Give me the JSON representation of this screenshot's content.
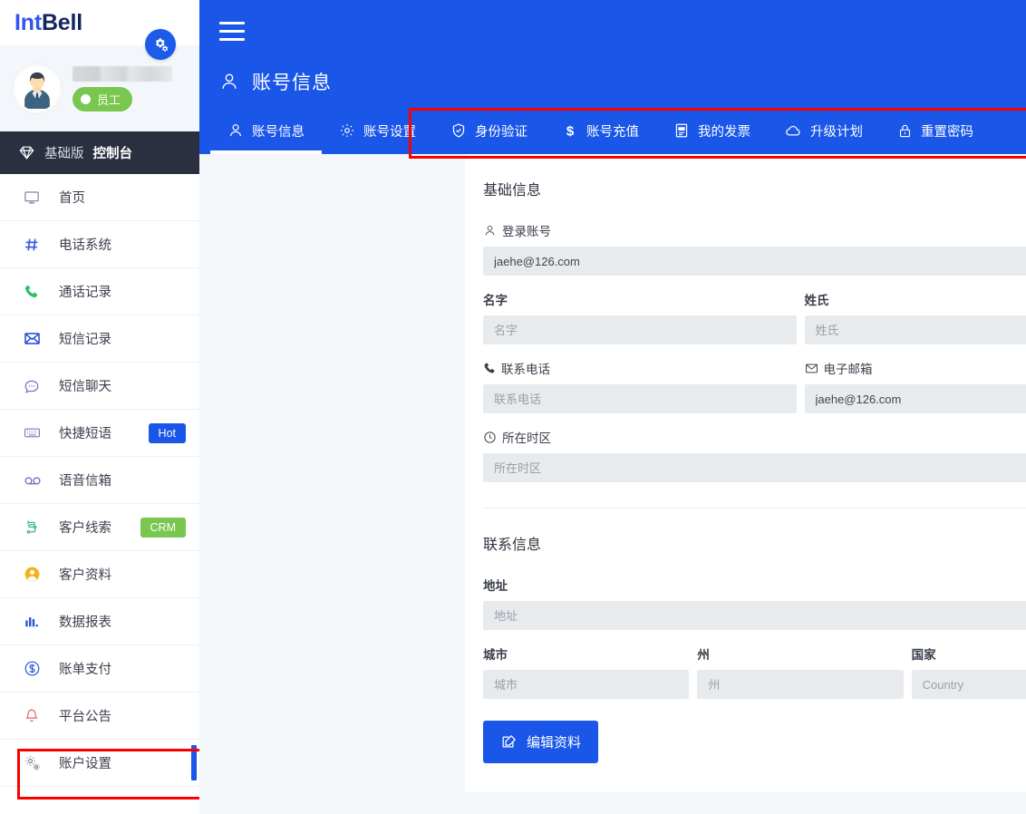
{
  "brand": {
    "part1": "Int",
    "part2": "Bell"
  },
  "profile": {
    "gear_fab_icon": "gears-icon",
    "username_redacted": "",
    "role_label": "员工"
  },
  "console": {
    "edition": "基础版",
    "label": "控制台",
    "icon": "diamond-icon"
  },
  "sidebar": {
    "items": [
      {
        "label": "首页",
        "icon": "monitor-icon",
        "badge": null,
        "active": false
      },
      {
        "label": "电话系统",
        "icon": "hash-icon",
        "badge": null,
        "active": false
      },
      {
        "label": "通话记录",
        "icon": "phone-icon",
        "badge": null,
        "active": false
      },
      {
        "label": "短信记录",
        "icon": "envelope-icon",
        "badge": null,
        "active": false
      },
      {
        "label": "短信聊天",
        "icon": "chat-icon",
        "badge": null,
        "active": false
      },
      {
        "label": "快捷短语",
        "icon": "keyboard-icon",
        "badge": "Hot",
        "badge_type": "hot",
        "active": false
      },
      {
        "label": "语音信箱",
        "icon": "voicemail-icon",
        "badge": null,
        "active": false
      },
      {
        "label": "客户线索",
        "icon": "flow-icon",
        "badge": "CRM",
        "badge_type": "crm",
        "active": false
      },
      {
        "label": "客户资料",
        "icon": "user-circle-icon",
        "badge": null,
        "active": false
      },
      {
        "label": "数据报表",
        "icon": "bar-chart-icon",
        "badge": null,
        "active": false
      },
      {
        "label": "账单支付",
        "icon": "dollar-circle-icon",
        "badge": null,
        "active": false
      },
      {
        "label": "平台公告",
        "icon": "bell-icon",
        "badge": null,
        "active": false
      },
      {
        "label": "账户设置",
        "icon": "gears-icon",
        "badge": null,
        "active": true
      }
    ]
  },
  "header": {
    "menu_icon": "hamburger-icon",
    "page_icon": "user-icon",
    "title": "账号信息",
    "tabs": [
      {
        "label": "账号信息",
        "icon": "user-icon",
        "active": true
      },
      {
        "label": "账号设置",
        "icon": "gear-icon",
        "active": false
      },
      {
        "label": "身份验证",
        "icon": "shield-check-icon",
        "active": false
      },
      {
        "label": "账号充值",
        "icon": "dollar-icon",
        "active": false
      },
      {
        "label": "我的发票",
        "icon": "invoice-icon",
        "active": false
      },
      {
        "label": "升级计划",
        "icon": "cloud-icon",
        "active": false
      },
      {
        "label": "重置密码",
        "icon": "lock-icon",
        "active": false
      }
    ]
  },
  "form": {
    "basic_section_title": "基础信息",
    "login_account": {
      "label": "登录账号",
      "icon": "user-icon",
      "value": "jaehe@126.com",
      "placeholder": ""
    },
    "first_name": {
      "label": "名字",
      "value": "",
      "placeholder": "名字"
    },
    "last_name": {
      "label": "姓氏",
      "value": "",
      "placeholder": "姓氏"
    },
    "phone": {
      "label": "联系电话",
      "icon": "phone-icon",
      "value": "",
      "placeholder": "联系电话"
    },
    "email": {
      "label": "电子邮箱",
      "icon": "envelope-icon",
      "value": "jaehe@126.com",
      "placeholder": ""
    },
    "timezone": {
      "label": "所在时区",
      "icon": "clock-icon",
      "value": "",
      "placeholder": "所在时区"
    },
    "contact_section_title": "联系信息",
    "address": {
      "label": "地址",
      "value": "",
      "placeholder": "地址"
    },
    "city": {
      "label": "城市",
      "value": "",
      "placeholder": "城市"
    },
    "state": {
      "label": "州",
      "value": "",
      "placeholder": "州"
    },
    "country": {
      "label": "国家",
      "value": "",
      "placeholder": "Country"
    },
    "edit_button": {
      "label": "编辑资料",
      "icon": "edit-pencil-icon"
    }
  },
  "colors": {
    "primary_blue": "#1a56e8",
    "dark_nav": "#2b3040",
    "green_badge": "#7ac74f",
    "highlight_red": "#fc0000",
    "input_bg": "#e7ebee",
    "page_bg": "#f4f7fa"
  }
}
